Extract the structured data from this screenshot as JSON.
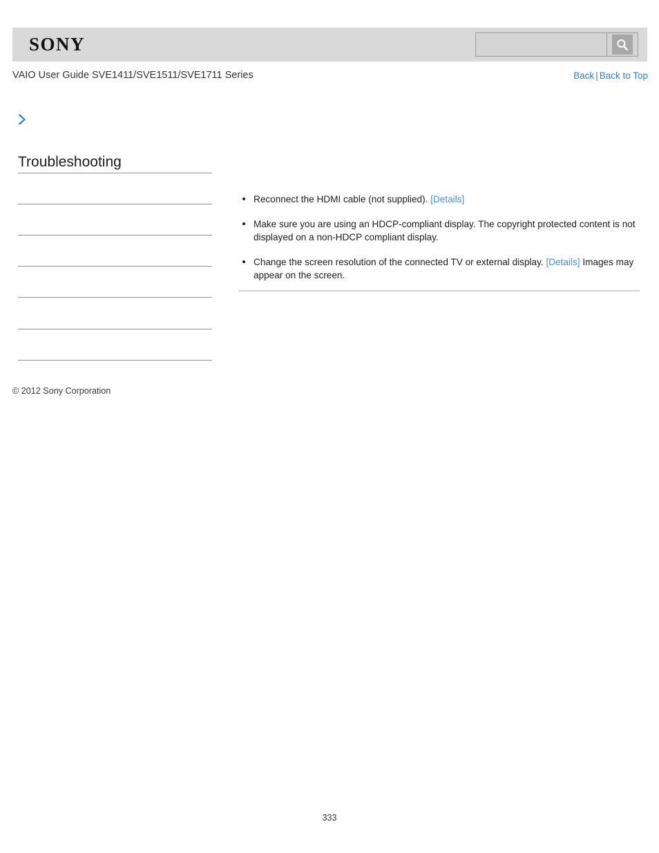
{
  "header": {
    "logo_text": "SONY",
    "search": {
      "value": "",
      "placeholder": "",
      "icon": "search-icon",
      "button_label": ""
    }
  },
  "subheader": {
    "guide_title": "VAIO User Guide SVE1411/SVE1511/SVE1711 Series",
    "nav": {
      "back_label": "Back",
      "separator": "|",
      "back_to_top_label": "Back to Top"
    }
  },
  "breadcrumb": {
    "arrow_icon": "chevron-right-icon",
    "text": ""
  },
  "sidebar": {
    "title": "Troubleshooting",
    "items": [
      {
        "label": ""
      },
      {
        "label": ""
      },
      {
        "label": ""
      },
      {
        "label": ""
      },
      {
        "label": ""
      },
      {
        "label": ""
      }
    ]
  },
  "main": {
    "bullets": [
      {
        "segments": [
          {
            "type": "text",
            "value": "Reconnect the HDMI cable (not supplied). "
          },
          {
            "type": "link",
            "value": "[Details]"
          }
        ]
      },
      {
        "segments": [
          {
            "type": "text",
            "value": "Make sure you are using an HDCP-compliant display. The copyright protected content is not displayed on a non-HDCP compliant display."
          }
        ]
      },
      {
        "segments": [
          {
            "type": "text",
            "value": "Change the screen resolution of the connected TV or external display. "
          },
          {
            "type": "link",
            "value": "[Details]"
          },
          {
            "type": "text",
            "value": " Images may appear on the screen."
          }
        ]
      }
    ]
  },
  "footer": {
    "copyright": "© 2012 Sony Corporation",
    "page_number": "333"
  },
  "colors": {
    "header_band": "#d9d9d9",
    "link_blue": "#2f7ec4",
    "detail_link_blue": "#4a90d9",
    "arrow_blue": "#2a7cbe",
    "rule_gray": "#8e8e8e"
  }
}
